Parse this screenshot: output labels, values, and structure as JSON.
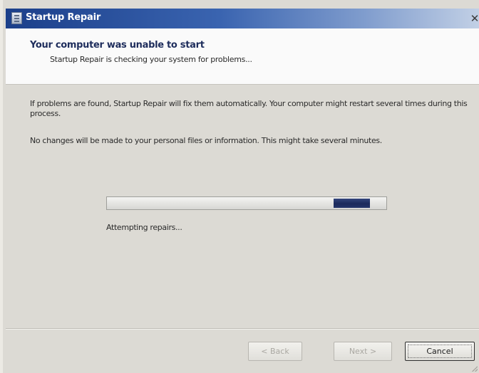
{
  "window": {
    "title": "Startup Repair",
    "close_glyph": "✕",
    "title_icon": "document-icon"
  },
  "header": {
    "title": "Your computer was unable to start",
    "subtitle": "Startup Repair is checking your system for problems..."
  },
  "body": {
    "paragraph_1": "If problems are found, Startup Repair will fix them automatically. Your computer might restart several times during this process.",
    "paragraph_2": "No changes will be made to your personal files or information. This might take several minutes."
  },
  "progress": {
    "type": "marquee",
    "chunk_start_fraction": 0.81,
    "chunk_width_fraction": 0.13,
    "status_text": "Attempting repairs..."
  },
  "buttons": {
    "back_label": "< Back",
    "next_label": "Next >",
    "cancel_label": "Cancel",
    "back_enabled": false,
    "next_enabled": false
  },
  "colors": {
    "titlebar_start": "#1b3f8a",
    "progress_fill": "#1b2a5c",
    "header_title": "#1e2d5c"
  }
}
